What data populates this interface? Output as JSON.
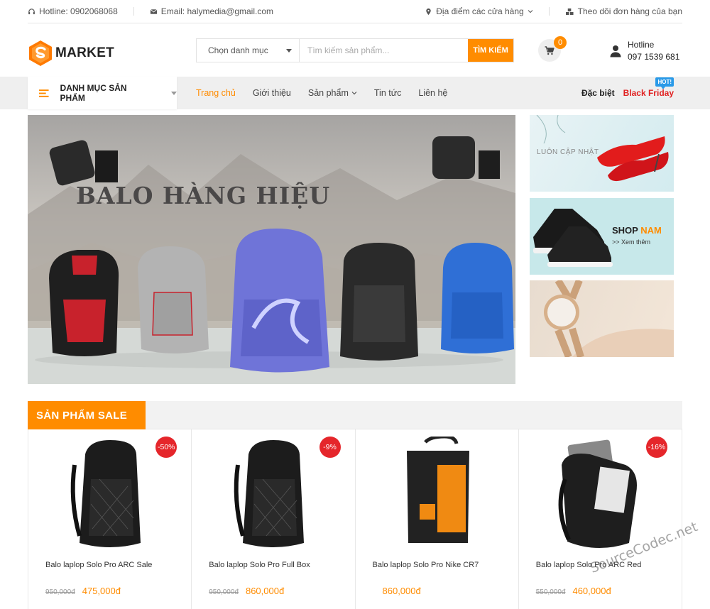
{
  "topbar": {
    "hotline": "Hotline: 0902068068",
    "email": "Email: halymedia@gmail.com",
    "stores": "Địa điểm các cửa hàng",
    "track_order": "Theo dõi đơn hàng của bạn"
  },
  "header": {
    "logo_text": "MARKET",
    "category_select": "Chọn danh mục",
    "search_placeholder": "Tìm kiếm sản phẩm...",
    "search_button": "TÌM KIẾM",
    "cart_count": "0",
    "hotline_label": "Hotline",
    "hotline_number": "097 1539 681"
  },
  "nav": {
    "category_menu": "DANH MỤC SẢN PHẨM",
    "links": [
      "Trang chủ",
      "Giới thiệu",
      "Sản phẩm",
      "Tin tức",
      "Liên hệ"
    ],
    "special_label": "Đặc biệt",
    "special_link": "Black Friday",
    "hot_badge": "HOT!"
  },
  "banner": {
    "title": "BALO HÀNG HIỆU"
  },
  "side_banners": {
    "b1_text": "LUÔN CẬP NHẬT",
    "b2_shop": "SHOP",
    "b2_nam": "NAM",
    "b2_more": ">> Xem thêm"
  },
  "sale": {
    "title": "SẢN PHẨM SALE",
    "products": [
      {
        "name": "Balo laplop Solo Pro ARC Sale",
        "old_price": "950,000đ",
        "price": "475,000đ",
        "discount": "-50%"
      },
      {
        "name": "Balo laplop Solo Pro Full Box",
        "old_price": "950,000đ",
        "price": "860,000đ",
        "discount": "-9%"
      },
      {
        "name": "Balo laplop Solo Pro Nike CR7",
        "old_price": "",
        "price": "860,000đ",
        "discount": ""
      },
      {
        "name": "Balo laplop Solo Pro ARC Red",
        "old_price": "550,000đ",
        "price": "460,000đ",
        "discount": "-16%"
      }
    ]
  },
  "watermark": "SourceCodec.net",
  "colors": {
    "accent": "#ff8c00",
    "sale_badge": "#e5262b",
    "black_friday": "#e01f1f",
    "hot_badge": "#2a9ae8"
  }
}
